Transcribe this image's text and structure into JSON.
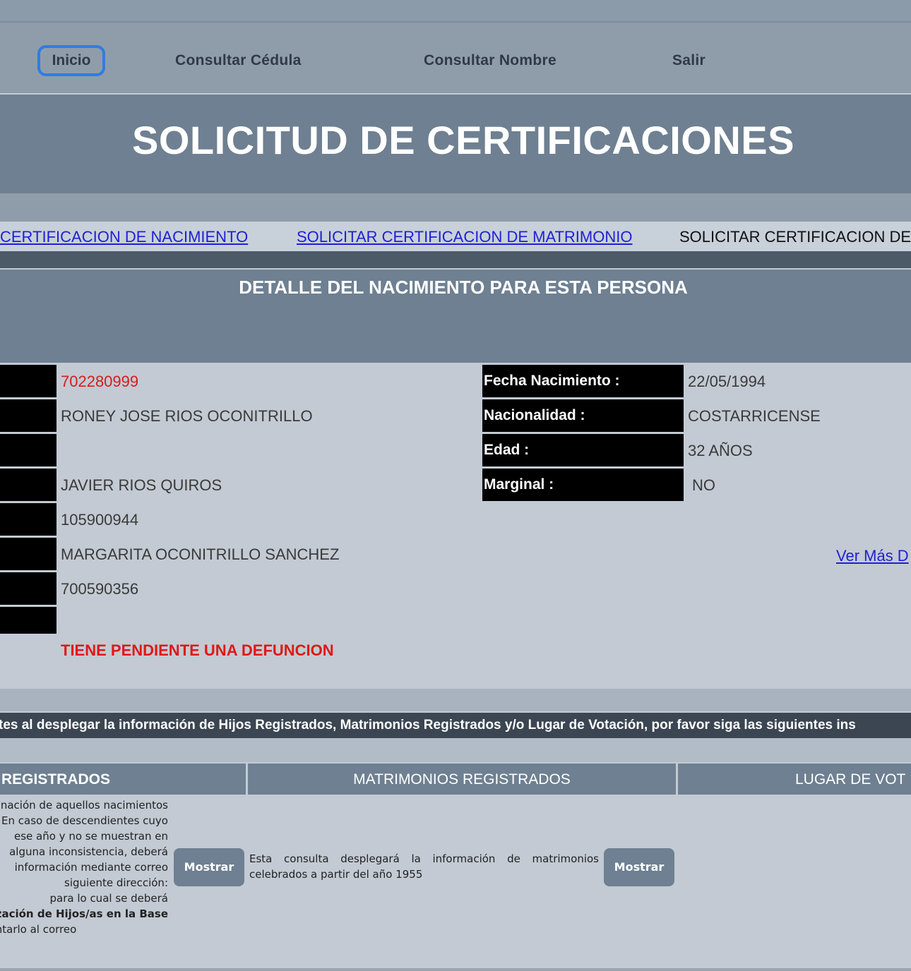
{
  "nav": {
    "inicio": "Inicio",
    "consultar_cedula": "Consultar Cédula",
    "consultar_nombre": "Consultar Nombre",
    "salir": "Salir"
  },
  "page_title": "SOLICITUD DE CERTIFICACIONES",
  "cert_links": {
    "nacimiento": "CERTIFICACION DE NACIMIENTO",
    "matrimonio": "SOLICITAR CERTIFICACION DE MATRIMONIO",
    "otra": "SOLICITAR CERTIFICACION DE"
  },
  "detail": {
    "title": "DETALLE DEL NACIMIENTO PARA ESTA PERSONA",
    "left_values": [
      "702280999",
      "RONEY JOSE RIOS OCONITRILLO",
      "",
      "JAVIER RIOS QUIROS",
      "105900944",
      "MARGARITA OCONITRILLO SANCHEZ",
      "700590356",
      ""
    ],
    "right": [
      {
        "label": "Fecha Nacimiento :",
        "value": "22/05/1994"
      },
      {
        "label": "Nacionalidad :",
        "value": "COSTARRICENSE"
      },
      {
        "label": "Edad :",
        "value": "32 AÑOS"
      },
      {
        "label": "Marginal :",
        "value": "NO"
      }
    ],
    "ver_mas": "Ver Más D",
    "alert": "TIENE PENDIENTE UNA DEFUNCION"
  },
  "instructions": "tes al desplegar la información de Hijos Registrados, Matrimonios Registrados y/o Lugar de Votación, por favor siga las siguientes ins",
  "sections": {
    "hijos": {
      "header": "REGISTRADOS",
      "lines": [
        "nación de aquellos nacimientos",
        "En caso de descendientes cuyo",
        "ese año y no se muestran en",
        "alguna inconsistencia, deberá",
        "información mediante correo",
        "siguiente dirección:",
        "para lo cual se deberá",
        "zación de Hijos/as en la Base",
        "ntarlo al correo"
      ],
      "button": "Mostrar"
    },
    "matrimonios": {
      "header": "MATRIMONIOS REGISTRADOS",
      "lines": [
        "Esta consulta desplegará la información de matrimonios",
        "celebrados a partir del año 1955"
      ],
      "button": "Mostrar"
    },
    "votacion": {
      "header": "LUGAR DE VOT"
    }
  }
}
